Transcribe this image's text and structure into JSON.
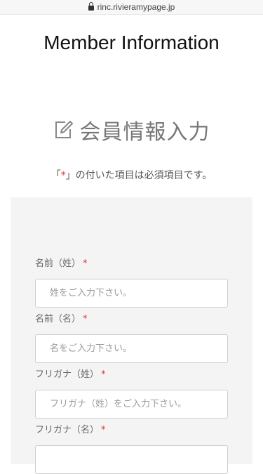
{
  "browser": {
    "url": "rinc.rivieramypage.jp"
  },
  "page": {
    "title": "Member Information"
  },
  "section": {
    "heading": "会員情報入力"
  },
  "note": {
    "prefix": "「",
    "marker": "*",
    "suffix": "」の付いた項目は必須項目です。"
  },
  "form": {
    "required_marker": "*",
    "fields": [
      {
        "label": "名前（姓）",
        "placeholder": "姓をご入力下さい。",
        "value": ""
      },
      {
        "label": "名前（名）",
        "placeholder": "名をご入力下さい。",
        "value": ""
      },
      {
        "label": "フリガナ（姓）",
        "placeholder": "フリガナ（姓）をご入力下さい。",
        "value": ""
      },
      {
        "label": "フリガナ（名）",
        "placeholder": "",
        "value": ""
      }
    ]
  },
  "colors": {
    "required": "#d9363e",
    "panel_bg": "#f4f4f4",
    "input_border": "#cfcfcf"
  }
}
